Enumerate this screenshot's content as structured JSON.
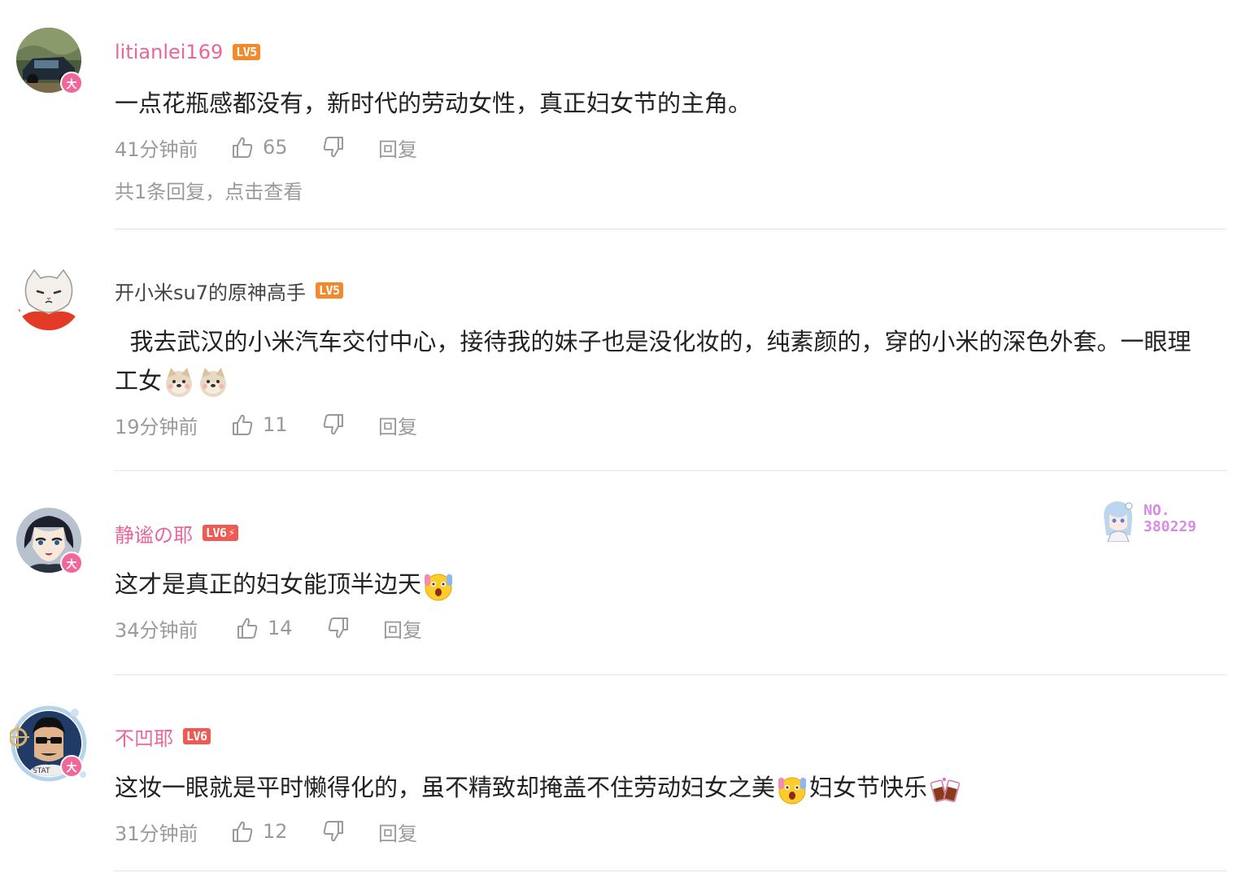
{
  "comments": [
    {
      "username": "litianlei169",
      "level": "LV5",
      "avatar_badge": "大",
      "text": "一点花瓶感都没有，新时代的劳动女性，真正妇女节的主角。",
      "time": "41分钟前",
      "likes": "65",
      "reply_label": "回复",
      "sub_replies": "共1条回复，点击查看"
    },
    {
      "username": "开小米su7的原神高手",
      "level": "LV5",
      "text": "  我去武汉的小米汽车交付中心，接待我的妹子也是没化妆的，纯素颜的，穿的小米的深色外套。一眼理工女",
      "emojis": [
        "doge-icon",
        "doge-icon"
      ],
      "time": "19分钟前",
      "likes": "11",
      "reply_label": "回复"
    },
    {
      "username": "静谧の耶",
      "level": "LV6",
      "avatar_badge": "大",
      "text": "这才是真正的妇女能顶半边天",
      "emojis": [
        "shocked-face-icon"
      ],
      "time": "34分钟前",
      "likes": "14",
      "reply_label": "回复",
      "fan_badge": {
        "line1": "NO.",
        "line2": "380229"
      }
    },
    {
      "username": "不凹耶",
      "level": "LV6",
      "avatar_badge": "大",
      "text_part1": "这妆一眼就是平时懒得化的，虽不精致却掩盖不住劳动妇女之美",
      "text_part2": "妇女节快乐",
      "emojis": [
        "shocked-face-icon",
        "cheers-icon"
      ],
      "time": "31分钟前",
      "likes": "12",
      "reply_label": "回复"
    }
  ],
  "colors": {
    "vip_name": "#e8669a",
    "meta_gray": "#9a9a9a",
    "lv5": "#f08a2c",
    "lv6": "#ef5a55",
    "badge_purple": "#d58ce2"
  }
}
